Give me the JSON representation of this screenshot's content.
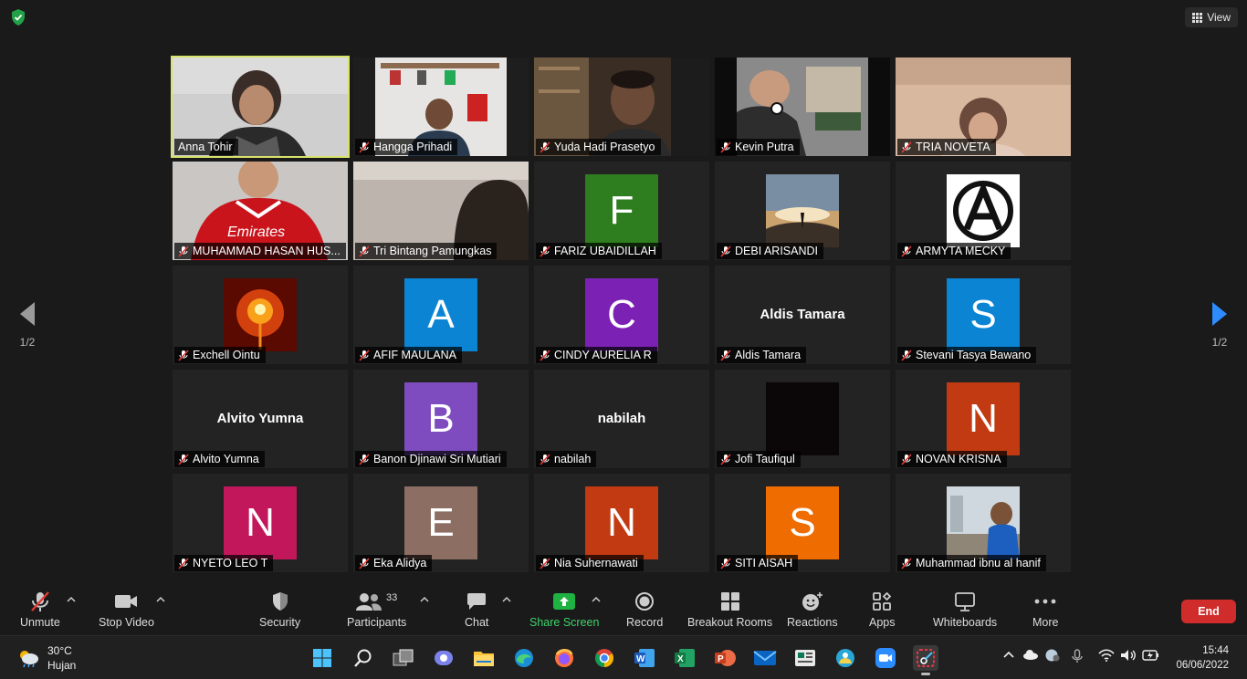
{
  "top": {
    "view_label": "View"
  },
  "participants": [
    {
      "name": "Anna Tohir",
      "kind": "video",
      "active": true,
      "muted": false
    },
    {
      "name": "Hangga Prihadi",
      "kind": "video",
      "muted": true
    },
    {
      "name": "Yuda Hadi Prasetyo",
      "kind": "video",
      "muted": true
    },
    {
      "name": "Kevin Putra",
      "kind": "video",
      "muted": true
    },
    {
      "name": "TRIA NOVETA",
      "kind": "video",
      "muted": true
    },
    {
      "name": "MUHAMMAD HASAN HUS...",
      "kind": "video",
      "muted": true
    },
    {
      "name": "Tri Bintang Pamungkas",
      "kind": "video",
      "muted": true
    },
    {
      "name": "FARIZ UBAIDILLAH",
      "kind": "letter",
      "letter": "F",
      "color": "#2e7d1f",
      "muted": true
    },
    {
      "name": "DEBI ARISANDI",
      "kind": "photo",
      "muted": true
    },
    {
      "name": "ARMYTA MECKY",
      "kind": "photo",
      "muted": true
    },
    {
      "name": "Exchell Ointu",
      "kind": "photo",
      "muted": true
    },
    {
      "name": "AFIF MAULANA",
      "kind": "letter",
      "letter": "A",
      "color": "#0b84d4",
      "muted": true
    },
    {
      "name": "CINDY AURELIA R",
      "kind": "letter",
      "letter": "C",
      "color": "#7b22b5",
      "muted": true
    },
    {
      "name": "Aldis Tamara",
      "kind": "text",
      "display": "Aldis Tamara",
      "muted": true
    },
    {
      "name": "Stevani Tasya Bawano",
      "kind": "letter",
      "letter": "S",
      "color": "#0b84d4",
      "muted": true
    },
    {
      "name": "Alvito Yumna",
      "kind": "text",
      "display": "Alvito Yumna",
      "muted": true
    },
    {
      "name": "Banon Djinawi Sri Mutiari",
      "kind": "letter",
      "letter": "B",
      "color": "#7f4cc0",
      "muted": true
    },
    {
      "name": "nabilah",
      "kind": "text",
      "display": "nabilah",
      "muted": true
    },
    {
      "name": "Jofi Taufiqul",
      "kind": "photo",
      "muted": true
    },
    {
      "name": "NOVAN KRISNA",
      "kind": "letter",
      "letter": "N",
      "color": "#c23a12",
      "muted": true
    },
    {
      "name": "NYETO LEO T",
      "kind": "letter",
      "letter": "N",
      "color": "#c2185b",
      "muted": true
    },
    {
      "name": "Eka Alidya",
      "kind": "letter",
      "letter": "E",
      "color": "#8d6e63",
      "muted": true
    },
    {
      "name": "Nia Suhernawati",
      "kind": "letter",
      "letter": "N",
      "color": "#c23a12",
      "muted": true
    },
    {
      "name": "SITI AISAH",
      "kind": "letter",
      "letter": "S",
      "color": "#ef6c00",
      "muted": true
    },
    {
      "name": "Muhammad ibnu al hanif",
      "kind": "photo",
      "muted": true
    }
  ],
  "pager": {
    "left": "1/2",
    "right": "1/2"
  },
  "toolbar": {
    "unmute": "Unmute",
    "stop_video": "Stop Video",
    "security": "Security",
    "participants": "Participants",
    "participants_count": "33",
    "chat": "Chat",
    "share_screen": "Share Screen",
    "record": "Record",
    "breakout_rooms": "Breakout Rooms",
    "reactions": "Reactions",
    "apps": "Apps",
    "whiteboards": "Whiteboards",
    "more": "More",
    "end": "End"
  },
  "taskbar": {
    "temperature": "30°C",
    "condition": "Hujan",
    "time": "15:44",
    "date": "06/06/2022",
    "apps": [
      "start-icon",
      "search-icon",
      "task-view-icon",
      "teams-chat-icon",
      "file-explorer-icon",
      "edge-icon",
      "firefox-icon",
      "chrome-icon",
      "word-icon",
      "excel-icon",
      "powerpoint-icon",
      "mail-icon",
      "news-icon",
      "weather-app-icon",
      "zoom-icon",
      "snipping-tool-icon"
    ]
  },
  "colors": {
    "active_speaker": "#d8e36b",
    "share_green": "#1fb141",
    "end_red": "#d12c2c",
    "background": "#1a1a1a"
  }
}
